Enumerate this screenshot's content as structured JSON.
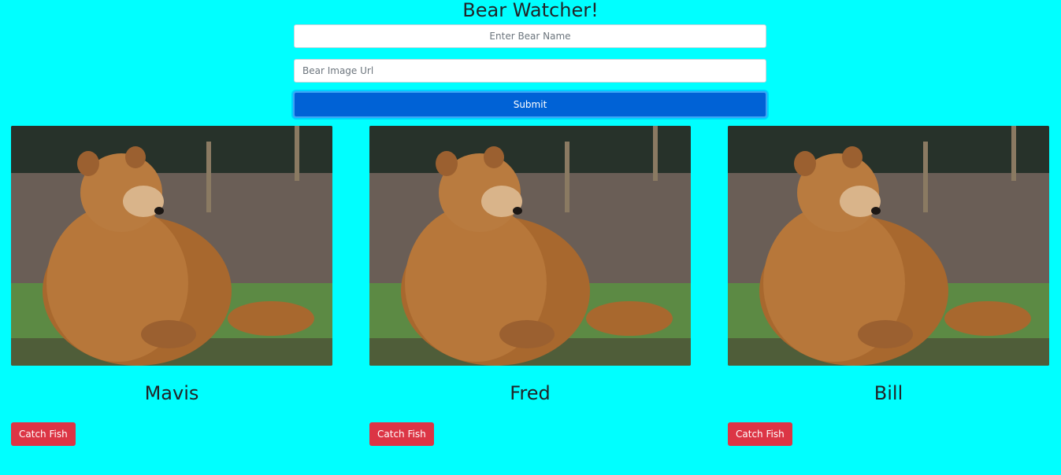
{
  "header": {
    "title": "Bear Watcher!"
  },
  "form": {
    "name_placeholder": "Enter Bear Name",
    "url_placeholder": "Bear Image Url",
    "submit_label": "Submit"
  },
  "bears": [
    {
      "name": "Mavis",
      "button_label": "Catch Fish"
    },
    {
      "name": "Fred",
      "button_label": "Catch Fish"
    },
    {
      "name": "Bill",
      "button_label": "Catch Fish"
    }
  ],
  "colors": {
    "background": "#00ffff",
    "submit": "#0062d6",
    "catch": "#dc3545"
  }
}
